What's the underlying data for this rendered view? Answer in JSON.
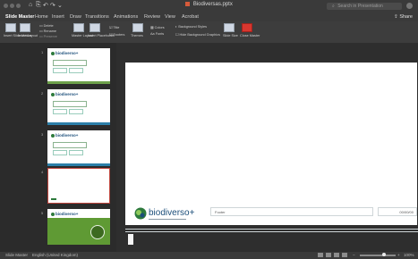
{
  "window": {
    "title": "Biodiversas.pptx",
    "search_placeholder": "Search in Presentation",
    "share_label": "Share"
  },
  "quick_access": {
    "home": "⌂",
    "save": "⎘",
    "undo": "↶",
    "redo": "↷",
    "more": "⌄"
  },
  "tabs": [
    "Slide Master",
    "Home",
    "Insert",
    "Draw",
    "Transitions",
    "Animations",
    "Review",
    "View",
    "Acrobat"
  ],
  "ribbon": {
    "insert_slide_master": "Insert Slide Master",
    "insert_layout": "Insert Layout",
    "delete": "Delete",
    "rename": "Rename",
    "preserve": "Preserve",
    "master_layout": "Master Layout",
    "insert_placeholder": "Insert Placeholder",
    "title": "Title",
    "footers": "Footers",
    "themes": "Themes",
    "colors": "Colors",
    "fonts": "Fonts",
    "background_styles": "Background Styles",
    "hide_background_graphics": "Hide Background Graphics",
    "slide_size": "Slide Size",
    "close_master": "Close Master"
  },
  "slide_panel": {
    "thumbs": [
      {
        "index": "1",
        "logo": "biodiverso+"
      },
      {
        "index": "2",
        "logo": "biodiverso+"
      },
      {
        "index": "3",
        "logo": "biodiverso+"
      },
      {
        "index": "4",
        "logo": ""
      },
      {
        "index": "5",
        "logo": "biodiverso+"
      }
    ]
  },
  "slide": {
    "logo_text": "biodiverso+",
    "footer_label": "Footer",
    "footer_right": "00/00/00"
  },
  "status": {
    "view": "Slide Master",
    "language": "English (United Kingdom)",
    "zoom": "100%"
  }
}
